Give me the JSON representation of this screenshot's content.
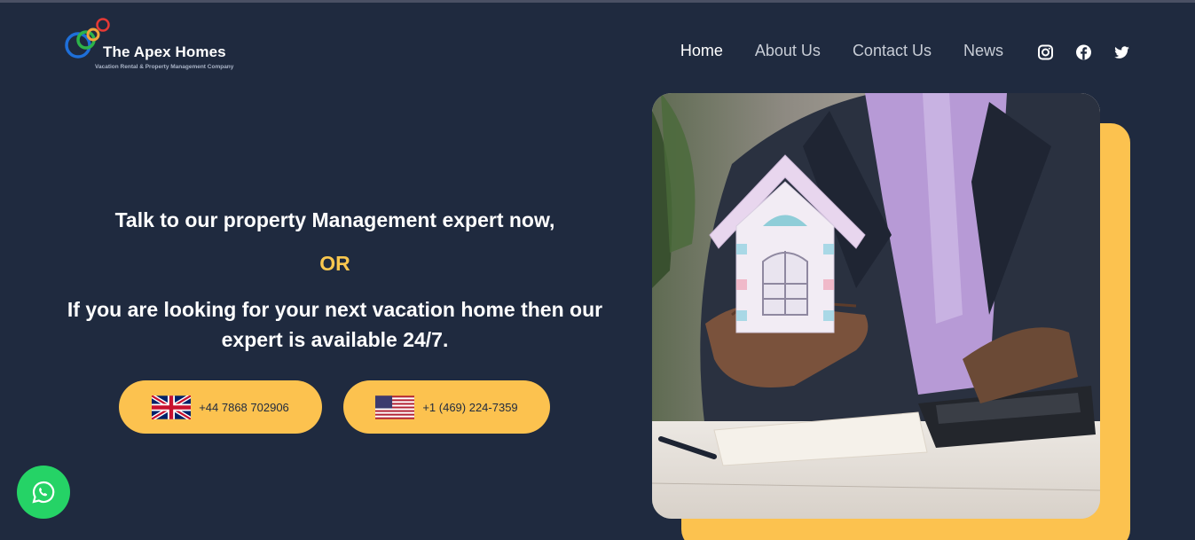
{
  "brand": {
    "name": "The Apex Homes",
    "tagline": "Vacation Rental & Property Management Company",
    "colors": {
      "background": "#1f2a3f",
      "accent": "#fcc24f",
      "or_text": "#f9c74f",
      "whatsapp": "#25d366"
    }
  },
  "nav": {
    "items": [
      {
        "label": "Home",
        "active": true
      },
      {
        "label": "About Us",
        "active": false
      },
      {
        "label": "Contact Us",
        "active": false
      },
      {
        "label": "News",
        "active": false
      }
    ]
  },
  "social": {
    "icons": [
      "instagram-icon",
      "facebook-icon",
      "twitter-icon"
    ]
  },
  "hero": {
    "line1": "Talk to our property Management expert now,",
    "or": "OR",
    "line2": "If you are looking for your next vacation home then our expert is available 24/7."
  },
  "phones": {
    "uk": {
      "number": "+44 7868 702906",
      "flag": "uk-flag-icon"
    },
    "us": {
      "number": "+1 (469) 224-7359",
      "flag": "us-flag-icon"
    }
  },
  "whatsapp": {
    "icon": "whatsapp-icon"
  }
}
